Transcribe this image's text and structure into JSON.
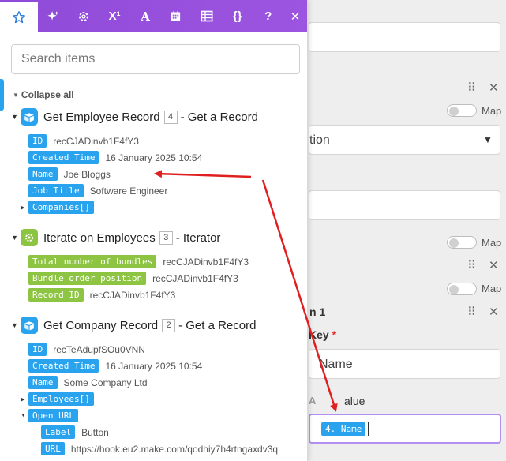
{
  "tabs": [
    {
      "name": "star-icon",
      "label": ""
    },
    {
      "name": "sparkles-icon",
      "label": ""
    },
    {
      "name": "gear-icon",
      "label": ""
    },
    {
      "name": "superscript-icon",
      "label": "X¹"
    },
    {
      "name": "text-icon",
      "label": "A"
    },
    {
      "name": "calendar-icon",
      "label": ""
    },
    {
      "name": "table-icon",
      "label": ""
    },
    {
      "name": "braces-icon",
      "label": "{}"
    },
    {
      "name": "help-icon",
      "label": "?"
    },
    {
      "name": "close-icon",
      "label": "✕"
    }
  ],
  "search": {
    "placeholder": "Search items"
  },
  "collapse_all": "Collapse all",
  "modules": [
    {
      "title": "Get Employee Record",
      "number": "4",
      "suffix": "- Get a Record",
      "items": [
        {
          "key": "ID",
          "value": "recCJADinvb1F4fY3"
        },
        {
          "key": "Created Time",
          "value": "16 January 2025 10:54"
        },
        {
          "key": "Name",
          "value": "Joe Bloggs"
        },
        {
          "key": "Job Title",
          "value": "Software Engineer"
        },
        {
          "key": "Companies[]",
          "value": ""
        }
      ]
    },
    {
      "title": "Iterate on Employees",
      "number": "3",
      "suffix": "- Iterator",
      "items": [
        {
          "key": "Total number of bundles",
          "value": "recCJADinvb1F4fY3"
        },
        {
          "key": "Bundle order position",
          "value": "recCJADinvb1F4fY3"
        },
        {
          "key": "Record ID",
          "value": "recCJADinvb1F4fY3"
        }
      ]
    },
    {
      "title": "Get Company Record",
      "number": "2",
      "suffix": "- Get a Record",
      "items": [
        {
          "key": "ID",
          "value": "recTeAdupfSOu0VNN"
        },
        {
          "key": "Created Time",
          "value": "16 January 2025 10:54"
        },
        {
          "key": "Name",
          "value": "Some Company Ltd"
        },
        {
          "key": "Employees[]",
          "value": ""
        },
        {
          "key": "Open URL",
          "value": ""
        },
        {
          "key": "Label",
          "value": "Button"
        },
        {
          "key": "URL",
          "value": "https://hook.eu2.make.com/qodhiy7h4rtngaxdv3q"
        }
      ]
    }
  ],
  "background": {
    "map_label": "Map",
    "select_text": "tion",
    "item_label": "n 1",
    "key_label": "Key",
    "required_mark": "*",
    "key_value": "Name",
    "value_label": "alue",
    "value_pill": "4. Name"
  },
  "colors": {
    "accent": "#9c55e0",
    "pill_blue": "#2aa3ef",
    "pill_green": "#8dc442",
    "arrow": "#e02020"
  }
}
